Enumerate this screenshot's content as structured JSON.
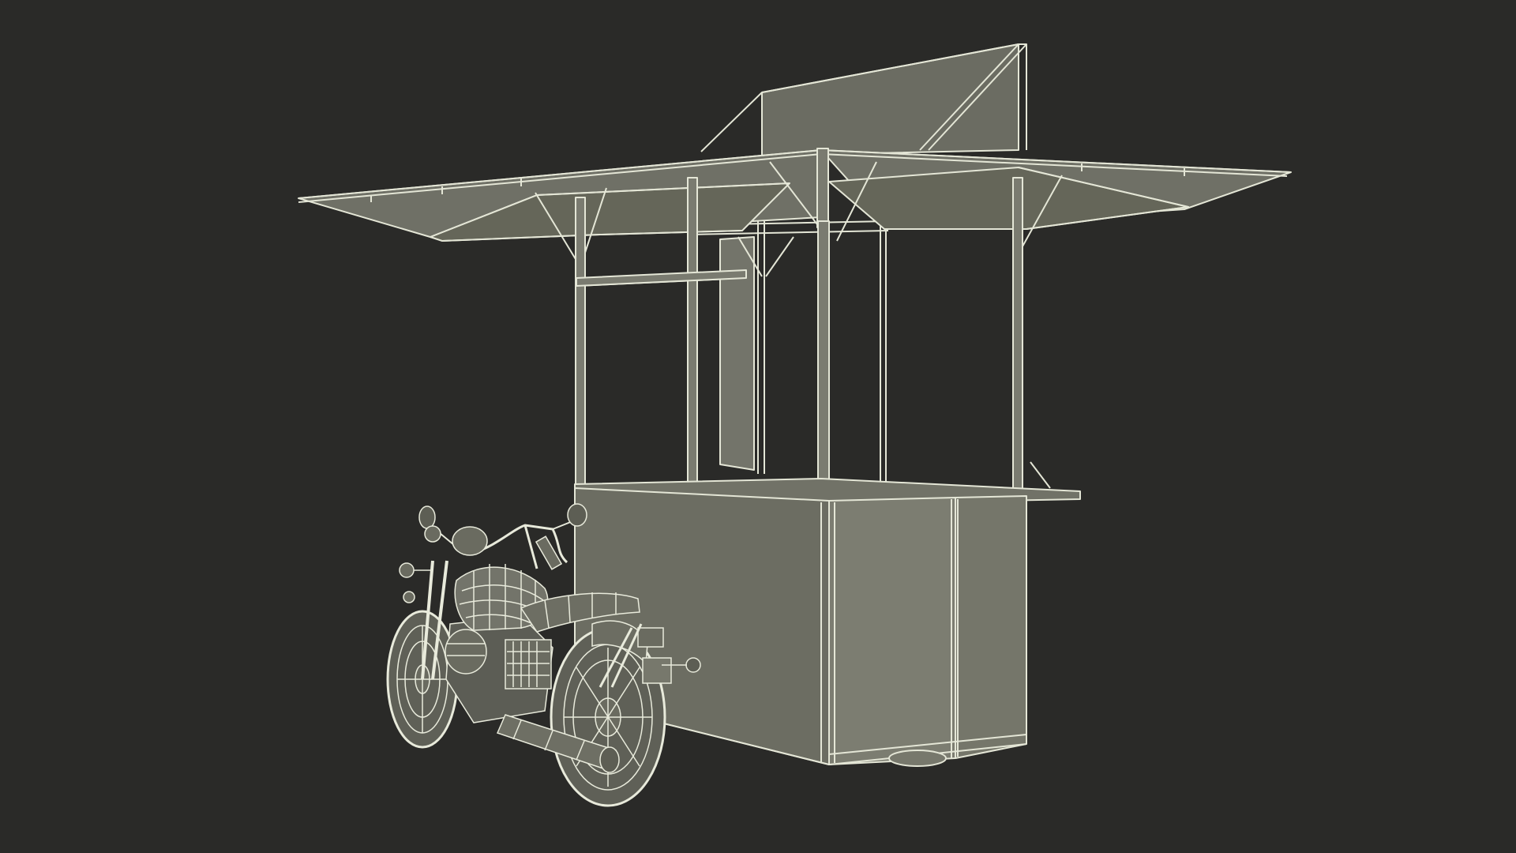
{
  "scene": {
    "background": "#2a2a28",
    "wire_color": "#e4e6d6",
    "panel_color": "#77786c",
    "panel_dark": "#606157",
    "panel_light": "#878879",
    "subject": [
      "vendor-kiosk",
      "motorcycle"
    ]
  }
}
